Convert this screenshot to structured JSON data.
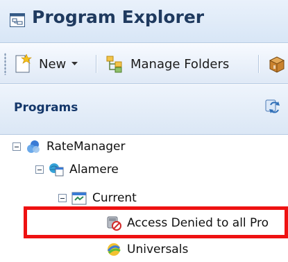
{
  "window": {
    "title": "Program Explorer",
    "icon": "explorer-window-icon"
  },
  "toolbar": {
    "new_label": "New",
    "new_icon": "new-document-icon",
    "manage_folders_label": "Manage Folders",
    "manage_folders_icon": "manage-folders-icon",
    "overflow_icon": "package-icon"
  },
  "panel": {
    "title": "Programs",
    "refresh_icon": "refresh-icon"
  },
  "tree": {
    "root": {
      "label": "RateManager",
      "icon": "rate-manager-icon",
      "expanded": true
    },
    "company": {
      "label": "Alamere",
      "icon": "company-icon",
      "expanded": true
    },
    "folder": {
      "label": "Current",
      "icon": "program-folder-icon",
      "expanded": true
    },
    "item_denied": {
      "label": "Access Denied to all Pro",
      "icon": "access-denied-icon",
      "highlighted": true
    },
    "item_universals": {
      "label": "Universals",
      "icon": "universals-icon"
    }
  },
  "colors": {
    "highlight": "#ee1111",
    "title_text": "#1f3a5f",
    "header_text": "#14376a"
  }
}
